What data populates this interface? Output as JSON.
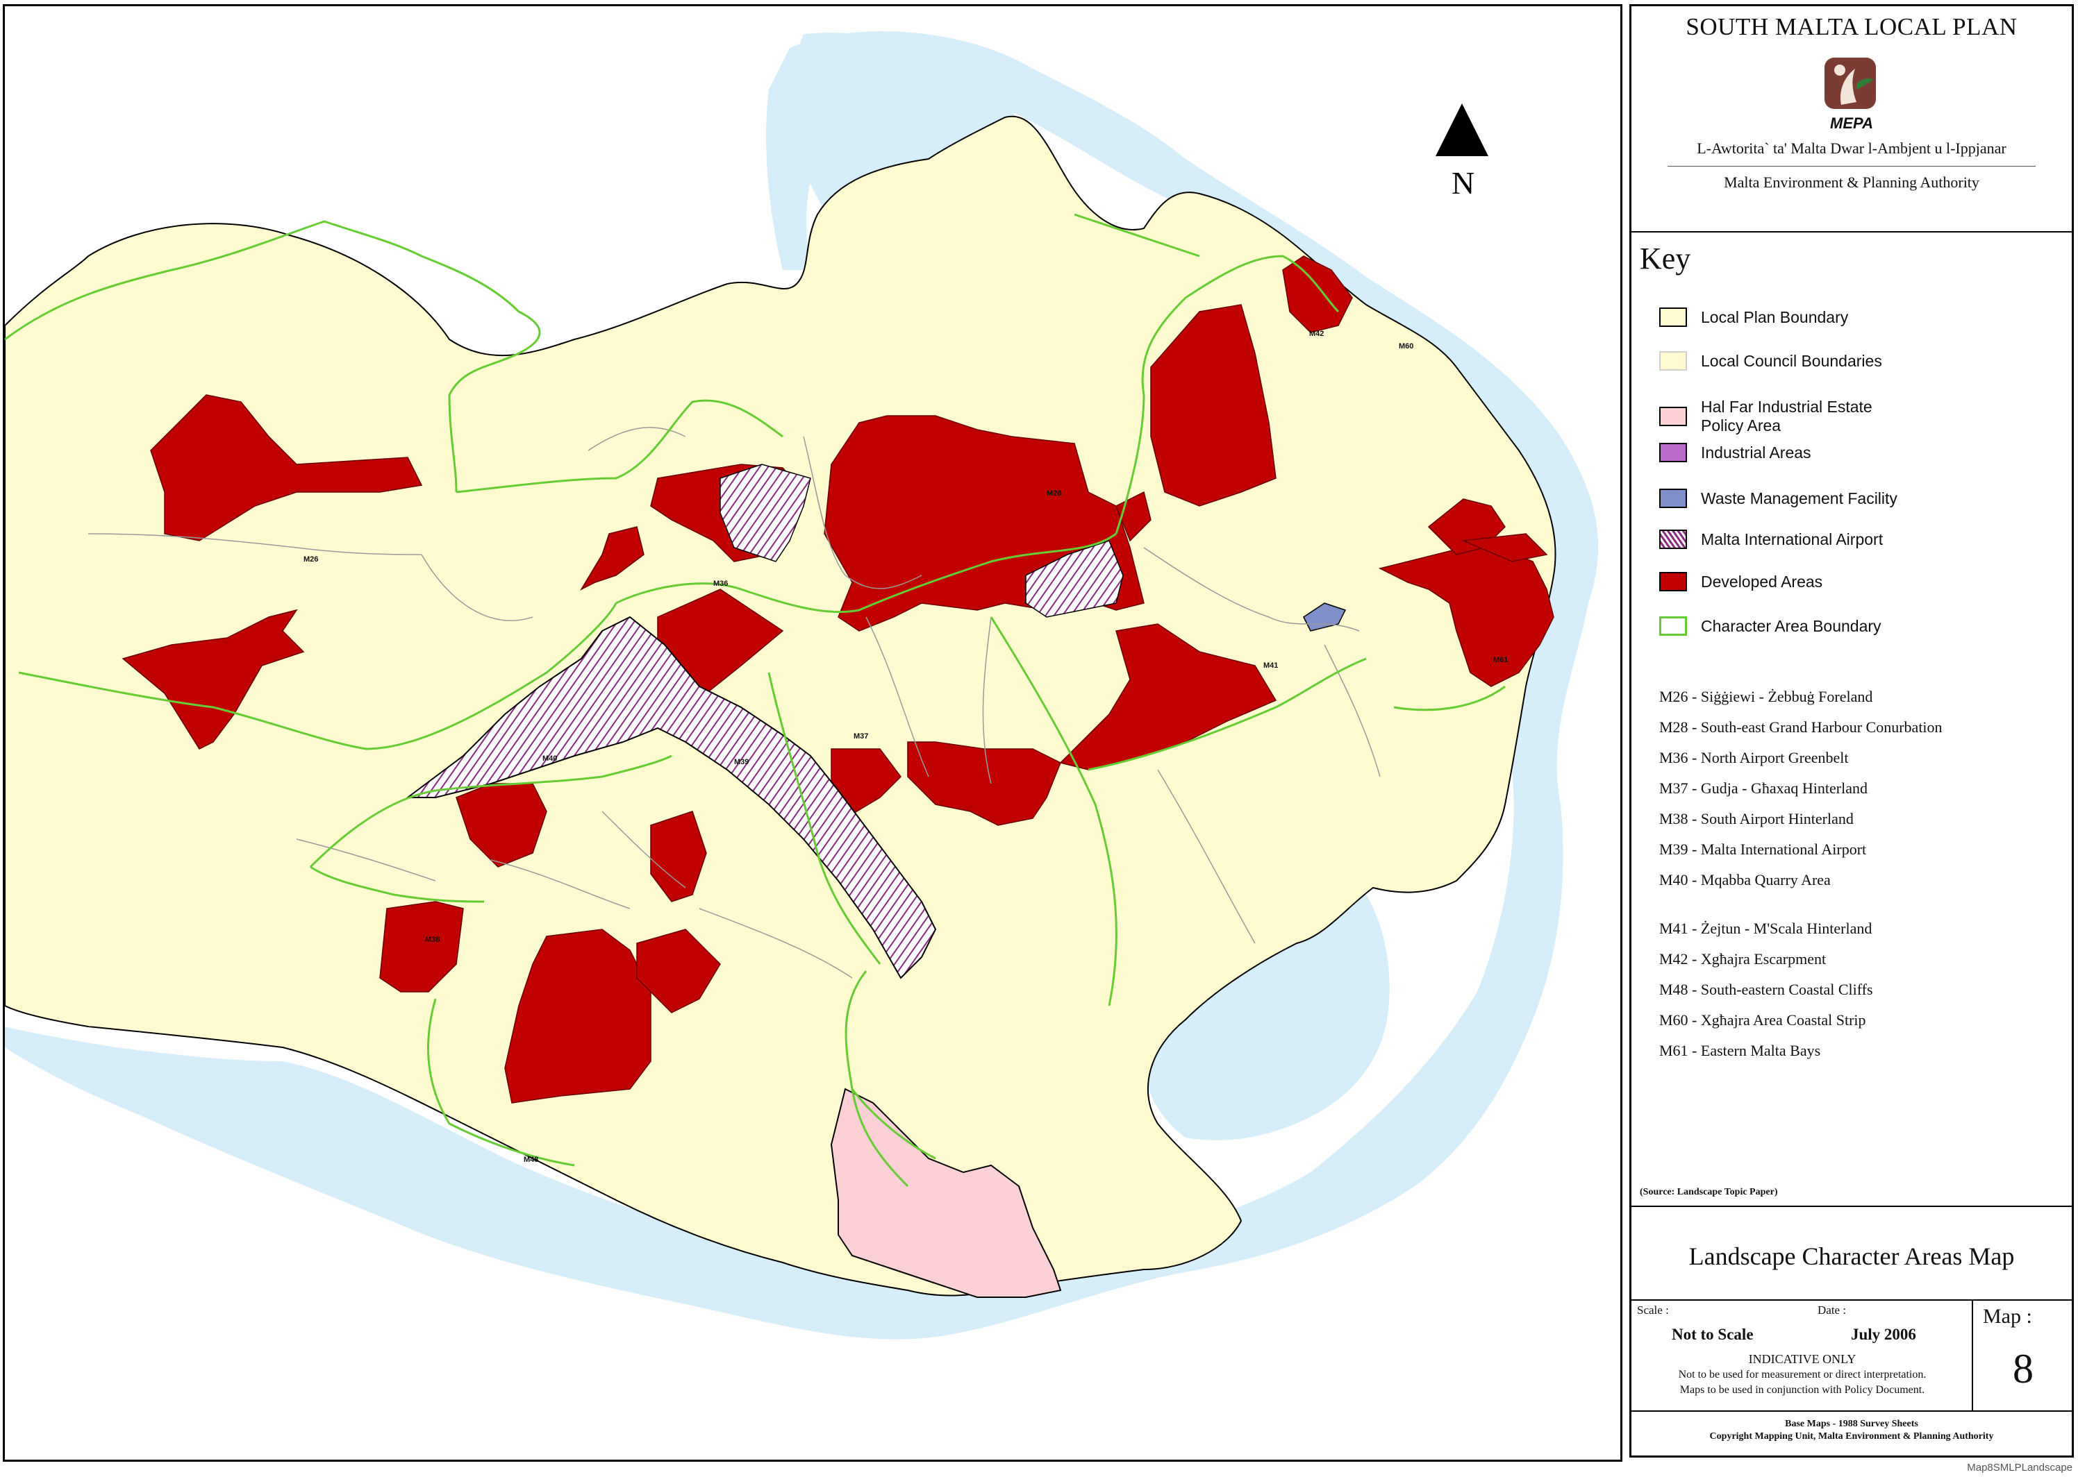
{
  "panel": {
    "plan_title": "SOUTH MALTA LOCAL PLAN",
    "logo_text": "MEPA",
    "authority_mt": "L-Awtorita` ta' Malta Dwar l-Ambjent u l-Ippjanar",
    "authority_en": "Malta Environment & Planning Authority",
    "key_title": "Key",
    "legend": [
      {
        "label": "Local Plan Boundary",
        "fill": "#fffbd0",
        "stroke": "#000000"
      },
      {
        "label": "Local Council Boundaries",
        "fill": "#fffbd0",
        "stroke": "#cccccc"
      },
      {
        "label_line1": "Hal Far Industrial Estate",
        "label_line2": "Policy Area",
        "fill": "#fcd0d4",
        "stroke": "#000000"
      },
      {
        "label": "Industrial Areas",
        "fill": "#b86ac8",
        "stroke": "#000000"
      },
      {
        "label": "Waste Management Facility",
        "fill": "#7f8fc9",
        "stroke": "#000000"
      },
      {
        "label": "Malta International Airport",
        "fill": "hatch",
        "stroke": "#000000"
      },
      {
        "label": "Developed Areas",
        "fill": "#c00000",
        "stroke": "#000000"
      },
      {
        "label": "Character Area Boundary",
        "fill": "#ffffff",
        "stroke": "#66cc33"
      }
    ],
    "character_areas": [
      "M26 - Siġġiewi - Żebbuġ Foreland",
      "M28 - South-east Grand Harbour Conurbation",
      "M36 - North Airport Greenbelt",
      "M37 - Gudja - Għaxaq Hinterland",
      "M38 - South Airport Hinterland",
      "M39 - Malta International Airport",
      "M40 - Mqabba Quarry Area",
      "M41 - Żejtun - M'Scala Hinterland",
      "M42 - Xgħajra Escarpment",
      "M48 - South-eastern Coastal Cliffs",
      "M60 - Xgħajra Area Coastal Strip",
      "M61 - Eastern Malta Bays"
    ],
    "source_note": "(Source: Landscape Topic Paper)",
    "map_name": "Landscape Character Areas Map",
    "scale_caption": "Scale :",
    "scale_value": "Not to Scale",
    "date_caption": "Date :",
    "date_value": "July 2006",
    "indicative": "INDICATIVE ONLY",
    "note_line1": "Not to be used for measurement or direct interpretation.",
    "note_line2": "Maps to be used in conjunction with Policy Document.",
    "map_caption": "Map :",
    "map_number": "8",
    "base_maps": "Base Maps - 1988 Survey Sheets",
    "copyright": "Copyright Mapping Unit, Malta Environment & Planning Authority"
  },
  "map": {
    "north_label": "N",
    "area_labels": [
      "M26",
      "M28",
      "M36",
      "M37",
      "M38",
      "M39",
      "M40",
      "M41",
      "M42",
      "M48",
      "M60",
      "M61"
    ],
    "colors": {
      "sea": "#d6eefa",
      "land": "#fffbd0",
      "developed": "#c00000",
      "industrial": "#b86ac8",
      "waste": "#7f8fc9",
      "hal_far": "#fcd0d4",
      "character_boundary": "#66cc33",
      "council_boundary": "#9a9a9a"
    }
  },
  "file_name": "Map8SMLPLandscape"
}
